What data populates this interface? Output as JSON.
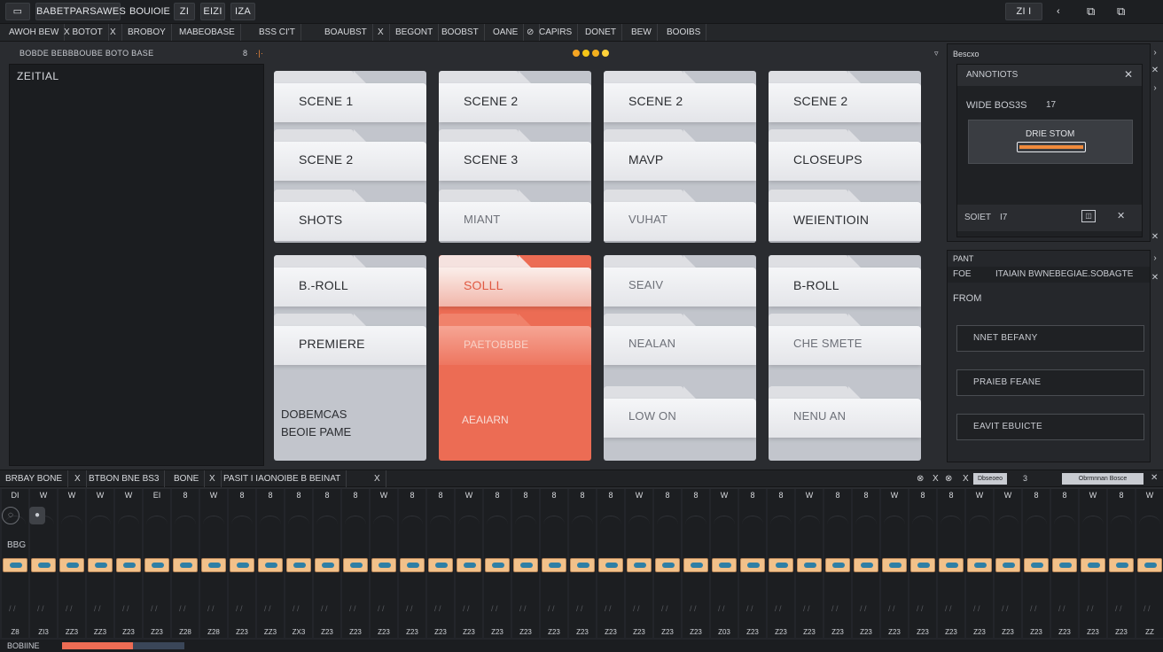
{
  "topbar": {
    "items": [
      "▭",
      "BABETPARSAWES",
      "BOUIOIE",
      "ZI",
      "EIZI",
      "IZA"
    ],
    "right_items": [
      "ZI I",
      "‹",
      "⧉",
      "⧉"
    ]
  },
  "menubar": {
    "items": [
      "AWOH BEW",
      "X BOTOT",
      "X",
      "BROBOY",
      "MABEOBASE",
      "BSS CI'T",
      "BOAUBST",
      "X",
      "BEGONT",
      "BOOBST",
      "OANE",
      "⊘",
      "CAPIRS",
      "DONET",
      "BEW",
      "BOOIBS"
    ]
  },
  "subheader": {
    "left_text": "BOBDE BEBBBOUBE BOTO BASE",
    "right_mark": "8",
    "right_mark2": "·|·"
  },
  "status_dots": [
    "#f5a623",
    "#f5c518",
    "#f2b01e",
    "#ffd23a"
  ],
  "left_panel": {
    "title": "ZEITIAL"
  },
  "folders": {
    "col1": [
      "SCENE 1",
      "SCENE 2",
      "SHOTS"
    ],
    "col2": [
      "SCENE 2",
      "SCENE 3",
      "MIANT"
    ],
    "col3": [
      "SCENE 2",
      "MAVP",
      "VUHAT"
    ],
    "col4": [
      "SCENE 2",
      "CLOSEUPS",
      "WEIENTIOIN"
    ],
    "col5": [
      "B.-ROLL",
      "PREMIERE"
    ],
    "col5_text": [
      "DOBEMCAS",
      "BEOIE PAME"
    ],
    "col6": [
      "SOLLL",
      "PAETOBBBE"
    ],
    "col6_text": "AEAIARN",
    "col7": [
      "SEAIV",
      "NEALAN",
      "LOW ON"
    ],
    "col8": [
      "B-ROLL",
      "CHE SMETE",
      "NENU AN"
    ]
  },
  "right_panel": {
    "top_header": "Bescxo",
    "row1": "ANNOTIOTS",
    "row2_label": "WIDE BOS3S",
    "row2_value": "17",
    "preview_label": "DRIE STOM",
    "row3_label": "SOIET",
    "row3_value": "I7",
    "mid_header": "PANT",
    "mid_row": "FOE",
    "mid_row_value": "ITAIAIN BWNEBEGIAE.SOBAGTE",
    "from_label": "FROM",
    "buttons": [
      "NNET BEFANY",
      "PRAIEB FEANE",
      "EAVIT EBUICTE"
    ]
  },
  "timeline": {
    "header_items": [
      "BRBAY BONE",
      "X",
      "BTBON BNE BS3",
      "BONE",
      "X",
      "PASIT I IAONOIBE B BEINAT",
      "X"
    ],
    "header_right": [
      "⊗",
      "X",
      "⊗",
      "X"
    ],
    "header_right_box1": "Dbseoeo",
    "header_right_mark": "3",
    "header_right_box2": "Obrmnnan Bosce",
    "track_labels": [
      "DI",
      "W",
      "W",
      "W",
      "W",
      "EI",
      "8",
      "W",
      "8",
      "8",
      "8",
      "8",
      "8",
      "W",
      "8",
      "8",
      "W",
      "8",
      "8",
      "8",
      "8",
      "8",
      "W",
      "8",
      "8",
      "W",
      "8",
      "8",
      "W",
      "8",
      "8",
      "W",
      "8",
      "8",
      "W",
      "W",
      "8",
      "8",
      "W",
      "8",
      "W"
    ],
    "track_numbers": [
      "Z8",
      "ZI3",
      "ZZ3",
      "ZZ3",
      "Z23",
      "Z23",
      "Z28",
      "Z28",
      "Z23",
      "ZZ3",
      "ZX3",
      "Z23",
      "Z23",
      "Z23",
      "Z23",
      "Z23",
      "Z23",
      "Z23",
      "Z23",
      "Z23",
      "Z23",
      "Z23",
      "Z23",
      "Z23",
      "Z23",
      "Z03",
      "Z23",
      "Z23",
      "Z23",
      "Z23",
      "Z23",
      "Z23",
      "Z23",
      "Z23",
      "Z23",
      "Z23",
      "Z23",
      "Z23",
      "Z23",
      "Z23",
      "ZZ"
    ],
    "track_label_side": "BBG",
    "bottom_left": "BOBIINE"
  }
}
